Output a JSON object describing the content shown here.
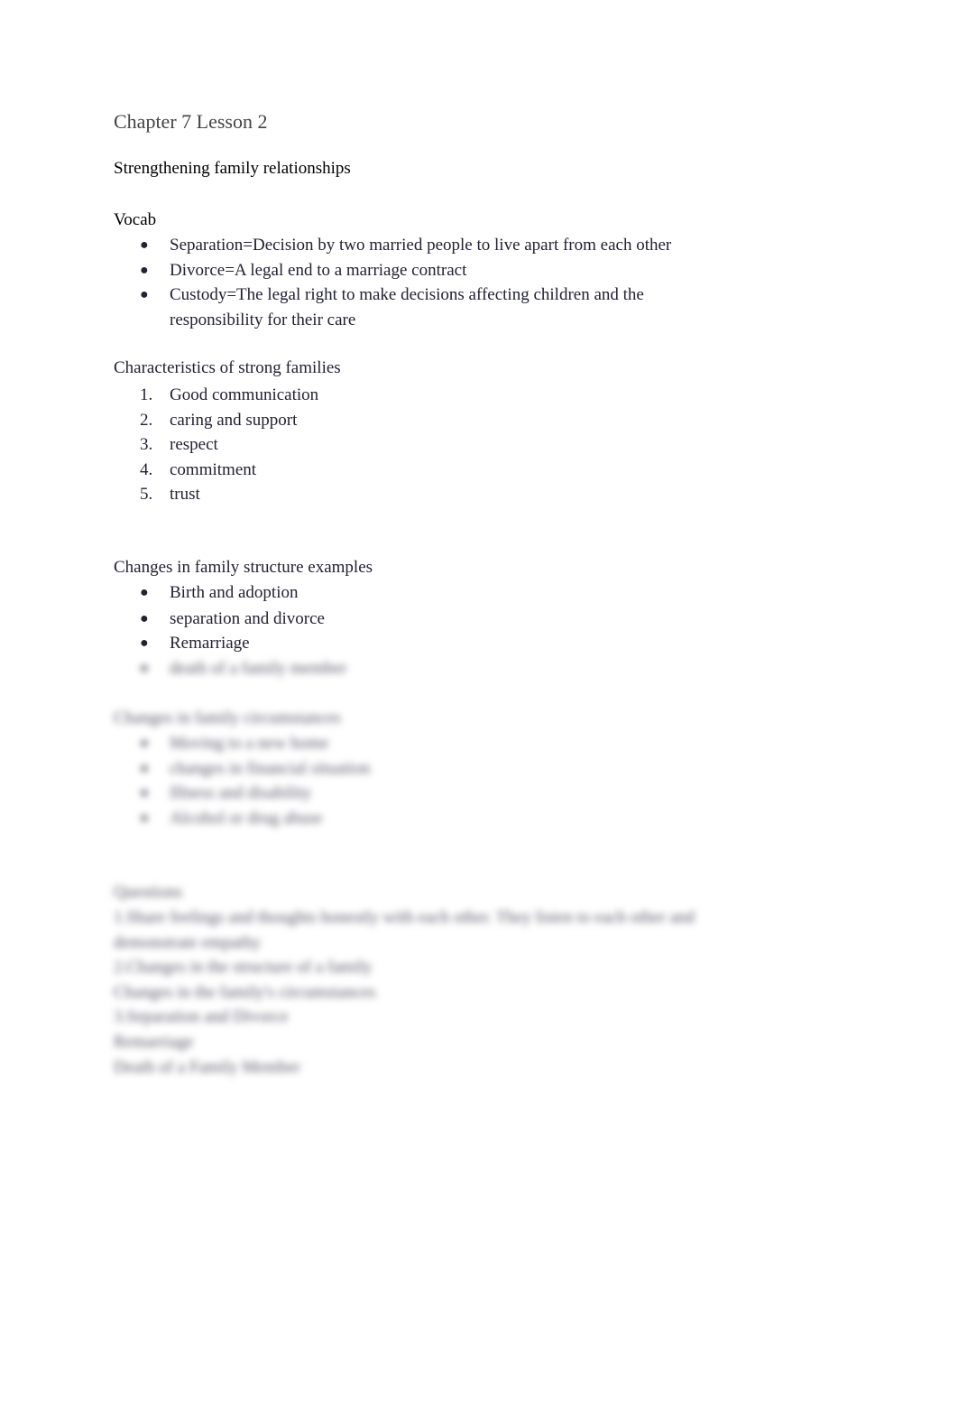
{
  "document": {
    "title": "Chapter 7 Lesson 2",
    "subtitle": "Strengthening family relationships",
    "vocab": {
      "heading": "Vocab",
      "items": [
        "Separation=Decision by two married people to live apart from each other",
        "Divorce=A legal end to a marriage contract",
        "Custody=The legal right to make decisions affecting children and the responsibility for their care"
      ]
    },
    "characteristics": {
      "heading": "Characteristics of strong families",
      "items": [
        "Good communication",
        "caring and support",
        "respect",
        "commitment",
        "trust"
      ]
    },
    "structure_changes": {
      "heading": "Changes in family structure examples",
      "items": [
        "Birth and adoption",
        "separation and divorce",
        "Remarriage",
        "death of a family member"
      ]
    },
    "circumstance_changes": {
      "heading": "Changes in family circumstances",
      "items": [
        "Moving to a new home",
        "changes in financial situation",
        "Illness and disability",
        "Alcohol or drug abuse"
      ]
    },
    "questions": {
      "heading": "Questions",
      "lines": [
        "1.Share feelings and thoughts honestly with each other. They listen to each other and demonstrate empathy",
        "2.Changes in the structure of a family",
        "Changes in the family's circumstances",
        "3.Separation and Divorce",
        "Remarriage",
        "Death of a Family Member"
      ]
    },
    "bullet_glyph": "●"
  }
}
